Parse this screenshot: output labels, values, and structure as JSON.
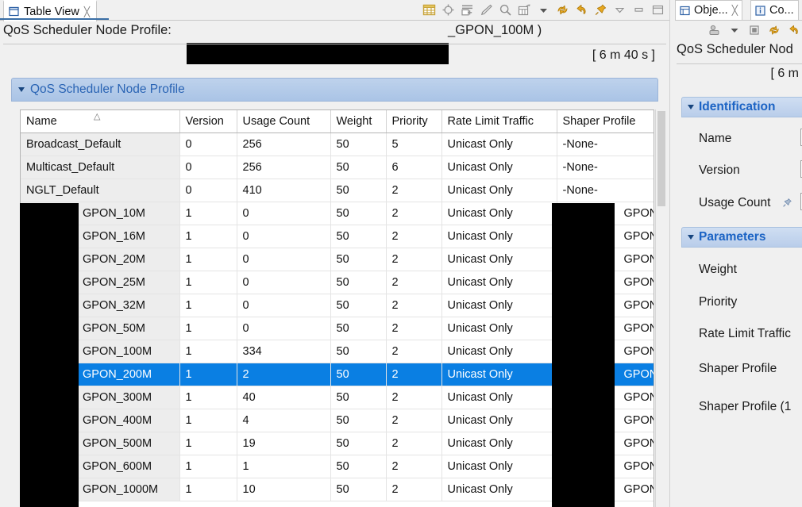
{
  "left_view": {
    "tab": {
      "label": "Table View",
      "close": "╳",
      "icon": "window-icon"
    },
    "header_label": "QoS Scheduler Node Profile:",
    "header_suffix": "_GPON_100M )",
    "elapsed": "[ 6 m 40 s ]",
    "section_title": "QoS Scheduler Node Profile",
    "toolbar_icons": [
      "table-icon",
      "target-icon",
      "table-add-icon",
      "pencil-icon",
      "magnifier-icon",
      "table-export-icon",
      "chevron-down-icon",
      "refresh-icon",
      "undo-icon",
      "pin-icon",
      "minimize-triangle-icon",
      "minimize-icon",
      "maximize-icon"
    ]
  },
  "table": {
    "columns": [
      "Name",
      "Version",
      "Usage Count",
      "Weight",
      "Priority",
      "Rate Limit Traffic",
      "Shaper Profile"
    ],
    "sort_column": "Name",
    "sort_direction": "ascending",
    "selected_row_index": 10,
    "rows": [
      {
        "name": "Broadcast_Default",
        "redacted_name": false,
        "version": "0",
        "usage_count": "256",
        "weight": "50",
        "priority": "5",
        "rate_limit_traffic": "Unicast Only",
        "shaper_profile": "-None-",
        "redacted_shaper": false
      },
      {
        "name": "Multicast_Default",
        "redacted_name": false,
        "version": "0",
        "usage_count": "256",
        "weight": "50",
        "priority": "6",
        "rate_limit_traffic": "Unicast Only",
        "shaper_profile": "-None-",
        "redacted_shaper": false
      },
      {
        "name": "NGLT_Default",
        "redacted_name": false,
        "version": "0",
        "usage_count": "410",
        "weight": "50",
        "priority": "2",
        "rate_limit_traffic": "Unicast Only",
        "shaper_profile": "-None-",
        "redacted_shaper": false
      },
      {
        "name": "GPON_10M",
        "redacted_name": true,
        "version": "1",
        "usage_count": "0",
        "weight": "50",
        "priority": "2",
        "rate_limit_traffic": "Unicast Only",
        "shaper_profile": "GPON",
        "redacted_shaper": true
      },
      {
        "name": "GPON_16M",
        "redacted_name": true,
        "version": "1",
        "usage_count": "0",
        "weight": "50",
        "priority": "2",
        "rate_limit_traffic": "Unicast Only",
        "shaper_profile": "GPON",
        "redacted_shaper": true
      },
      {
        "name": "GPON_20M",
        "redacted_name": true,
        "version": "1",
        "usage_count": "0",
        "weight": "50",
        "priority": "2",
        "rate_limit_traffic": "Unicast Only",
        "shaper_profile": "GPON",
        "redacted_shaper": true
      },
      {
        "name": "GPON_25M",
        "redacted_name": true,
        "version": "1",
        "usage_count": "0",
        "weight": "50",
        "priority": "2",
        "rate_limit_traffic": "Unicast Only",
        "shaper_profile": "GPON",
        "redacted_shaper": true
      },
      {
        "name": "GPON_32M",
        "redacted_name": true,
        "version": "1",
        "usage_count": "0",
        "weight": "50",
        "priority": "2",
        "rate_limit_traffic": "Unicast Only",
        "shaper_profile": "GPON",
        "redacted_shaper": true
      },
      {
        "name": "GPON_50M",
        "redacted_name": true,
        "version": "1",
        "usage_count": "0",
        "weight": "50",
        "priority": "2",
        "rate_limit_traffic": "Unicast Only",
        "shaper_profile": "GPON",
        "redacted_shaper": true
      },
      {
        "name": "GPON_100M",
        "redacted_name": true,
        "version": "1",
        "usage_count": "334",
        "weight": "50",
        "priority": "2",
        "rate_limit_traffic": "Unicast Only",
        "shaper_profile": "GPON",
        "redacted_shaper": true
      },
      {
        "name": "GPON_200M",
        "redacted_name": true,
        "version": "1",
        "usage_count": "2",
        "weight": "50",
        "priority": "2",
        "rate_limit_traffic": "Unicast Only",
        "shaper_profile": "GPON",
        "redacted_shaper": true
      },
      {
        "name": "GPON_300M",
        "redacted_name": true,
        "version": "1",
        "usage_count": "40",
        "weight": "50",
        "priority": "2",
        "rate_limit_traffic": "Unicast Only",
        "shaper_profile": "GPON",
        "redacted_shaper": true
      },
      {
        "name": "GPON_400M",
        "redacted_name": true,
        "version": "1",
        "usage_count": "4",
        "weight": "50",
        "priority": "2",
        "rate_limit_traffic": "Unicast Only",
        "shaper_profile": "GPON",
        "redacted_shaper": true
      },
      {
        "name": "GPON_500M",
        "redacted_name": true,
        "version": "1",
        "usage_count": "19",
        "weight": "50",
        "priority": "2",
        "rate_limit_traffic": "Unicast Only",
        "shaper_profile": "GPON",
        "redacted_shaper": true
      },
      {
        "name": "GPON_600M",
        "redacted_name": true,
        "version": "1",
        "usage_count": "1",
        "weight": "50",
        "priority": "2",
        "rate_limit_traffic": "Unicast Only",
        "shaper_profile": "GPON",
        "redacted_shaper": true
      },
      {
        "name": "GPON_1000M",
        "redacted_name": true,
        "version": "1",
        "usage_count": "10",
        "weight": "50",
        "priority": "2",
        "rate_limit_traffic": "Unicast Only",
        "shaper_profile": "GPON",
        "redacted_shaper": true
      }
    ]
  },
  "right_view": {
    "tabs": [
      {
        "label": "Obje...",
        "icon": "object-icon",
        "close": "╳"
      },
      {
        "label": "Co...",
        "icon": "info-icon"
      }
    ],
    "toolbar_icons": [
      "objects-icon",
      "chevron-down-icon",
      "stop-icon",
      "refresh-icon",
      "undo-icon"
    ],
    "title": "QoS Scheduler Nod",
    "elapsed": "[ 6 m",
    "groups": [
      {
        "title": "Identification",
        "fields": [
          {
            "label": "Name",
            "pinned": false
          },
          {
            "label": "Version",
            "pinned": false
          },
          {
            "label": "Usage Count",
            "pinned": true
          }
        ]
      },
      {
        "title": "Parameters",
        "fields": [
          {
            "label": "Weight",
            "pinned": false
          },
          {
            "label": "Priority",
            "pinned": false
          },
          {
            "label": "Rate Limit Traffic",
            "pinned": false
          },
          {
            "label": "Shaper Profile",
            "pinned": false
          },
          {
            "label": "Shaper Profile (1",
            "pinned": false
          }
        ]
      }
    ]
  },
  "colors": {
    "selection": "#0a7fe3",
    "section_header_text": "#2a64b4",
    "group_header_text": "#1b63c4",
    "redaction": "#000000",
    "row_name_bg": "#ededed",
    "tab_underline": "#3a6ea5"
  }
}
